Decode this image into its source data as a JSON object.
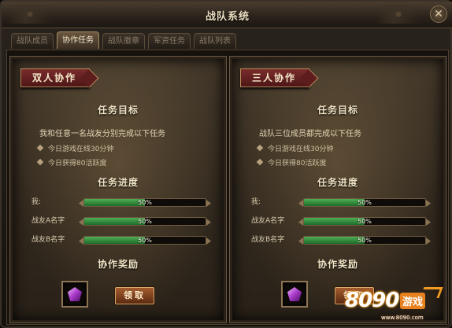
{
  "window": {
    "title": "战队系统",
    "close_glyph": "✕"
  },
  "tabs": [
    {
      "label": "战队成员",
      "active": false
    },
    {
      "label": "协作任务",
      "active": true
    },
    {
      "label": "战队徽章",
      "active": false
    },
    {
      "label": "军资任务",
      "active": false
    },
    {
      "label": "战队列表",
      "active": false
    }
  ],
  "panels": [
    {
      "ribbon": "双人协作",
      "goal_title": "任务目标",
      "goal_desc": "我和任意一名战友分别完成以下任务",
      "goals": [
        "今日游戏在线30分钟",
        "今日获得80活跃度"
      ],
      "progress_title": "任务进度",
      "progress": [
        {
          "label": "我:",
          "value_text": "50%",
          "fraction": 0.5
        },
        {
          "label": "战友A名字",
          "value_text": "50%",
          "fraction": 0.5
        },
        {
          "label": "战友B名字",
          "value_text": "50%",
          "fraction": 0.5
        }
      ],
      "reward_title": "协作奖励",
      "reward_icon": "purple-gem-icon",
      "claim_label": "领取"
    },
    {
      "ribbon": "三人协作",
      "goal_title": "任务目标",
      "goal_desc": "战队三位成员都完成以下任务",
      "goals": [
        "今日游戏在线30分钟",
        "今日获得80活跃度"
      ],
      "progress_title": "任务进度",
      "progress": [
        {
          "label": "我:",
          "value_text": "50%",
          "fraction": 0.5
        },
        {
          "label": "战友A名字",
          "value_text": "50%",
          "fraction": 0.5
        },
        {
          "label": "战友B名字",
          "value_text": "50%",
          "fraction": 0.5
        }
      ],
      "reward_title": "协作奖励",
      "reward_icon": "purple-gem-icon",
      "claim_label": "领取"
    }
  ],
  "watermark": {
    "number": "8090",
    "brand": "游戏",
    "url": "www.8090.com"
  },
  "colors": {
    "accent_red": "#7a2b2b",
    "progress_green": "#3a9443",
    "gem_purple": "#a83ac9"
  }
}
